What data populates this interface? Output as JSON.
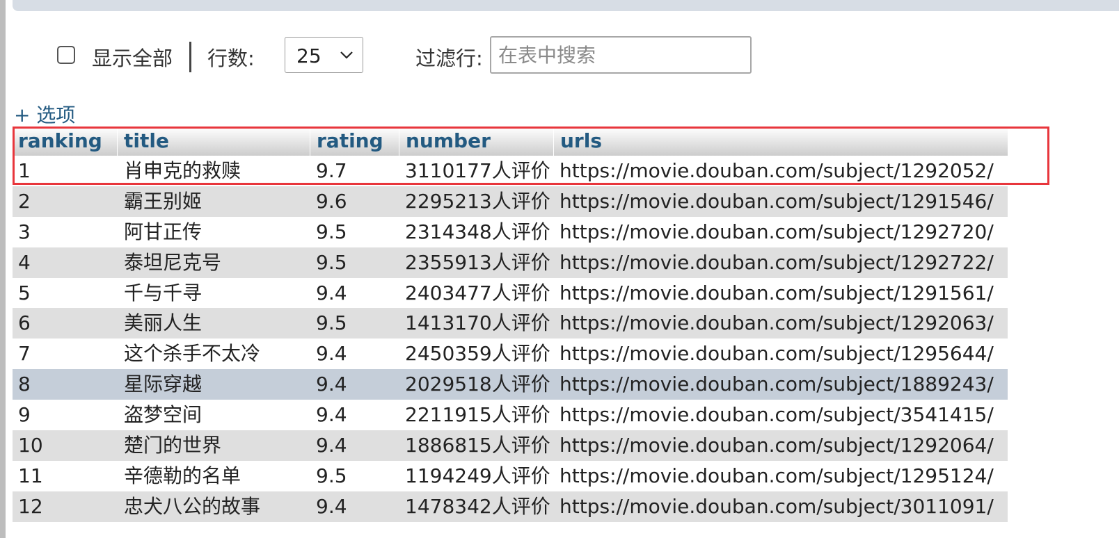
{
  "toolbar": {
    "show_all_label": "显示全部",
    "rows_label": "行数:",
    "rows_value": "25",
    "filter_label": "过滤行:",
    "filter_placeholder": "在表中搜索",
    "filter_value": ""
  },
  "options_link": "+ 选项",
  "table": {
    "columns": [
      "ranking",
      "title",
      "rating",
      "number",
      "urls"
    ],
    "rows": [
      [
        "1",
        "肖申克的救赎",
        "9.7",
        "3110177人评价",
        "https://movie.douban.com/subject/1292052/"
      ],
      [
        "2",
        "霸王别姬",
        "9.6",
        "2295213人评价",
        "https://movie.douban.com/subject/1291546/"
      ],
      [
        "3",
        "阿甘正传",
        "9.5",
        "2314348人评价",
        "https://movie.douban.com/subject/1292720/"
      ],
      [
        "4",
        "泰坦尼克号",
        "9.5",
        "2355913人评价",
        "https://movie.douban.com/subject/1292722/"
      ],
      [
        "5",
        "千与千寻",
        "9.4",
        "2403477人评价",
        "https://movie.douban.com/subject/1291561/"
      ],
      [
        "6",
        "美丽人生",
        "9.5",
        "1413170人评价",
        "https://movie.douban.com/subject/1292063/"
      ],
      [
        "7",
        "这个杀手不太冷",
        "9.4",
        "2450359人评价",
        "https://movie.douban.com/subject/1295644/"
      ],
      [
        "8",
        "星际穿越",
        "9.4",
        "2029518人评价",
        "https://movie.douban.com/subject/1889243/"
      ],
      [
        "9",
        "盗梦空间",
        "9.4",
        "2211915人评价",
        "https://movie.douban.com/subject/3541415/"
      ],
      [
        "10",
        "楚门的世界",
        "9.4",
        "1886815人评价",
        "https://movie.douban.com/subject/1292064/"
      ],
      [
        "11",
        "辛德勒的名单",
        "9.5",
        "1194249人评价",
        "https://movie.douban.com/subject/1295124/"
      ],
      [
        "12",
        "忠犬八公的故事",
        "9.4",
        "1478342人评价",
        "https://movie.douban.com/subject/3011091/"
      ]
    ]
  },
  "colors": {
    "header_text": "#235a81",
    "row_alt": "#dfdfdf",
    "row_hover": "#c5ced9",
    "annotation_box": "#e8363c"
  },
  "icons": {
    "select_arrow": "chevron-down-icon"
  }
}
